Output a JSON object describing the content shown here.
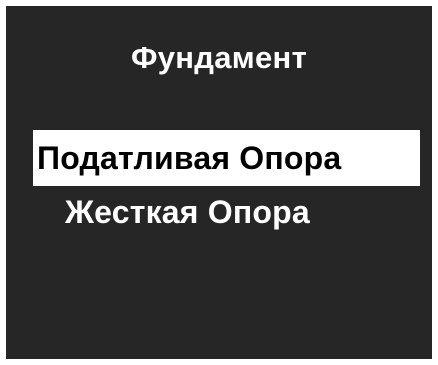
{
  "screen": {
    "title": "Фундамент"
  },
  "menu": {
    "items": [
      {
        "label": "Податливая Опора",
        "selected": true
      },
      {
        "label": "Жесткая Опора",
        "selected": false
      }
    ]
  },
  "colors": {
    "background": "#262626",
    "text": "#ffffff",
    "selected_background": "#ffffff",
    "selected_text": "#000000"
  }
}
